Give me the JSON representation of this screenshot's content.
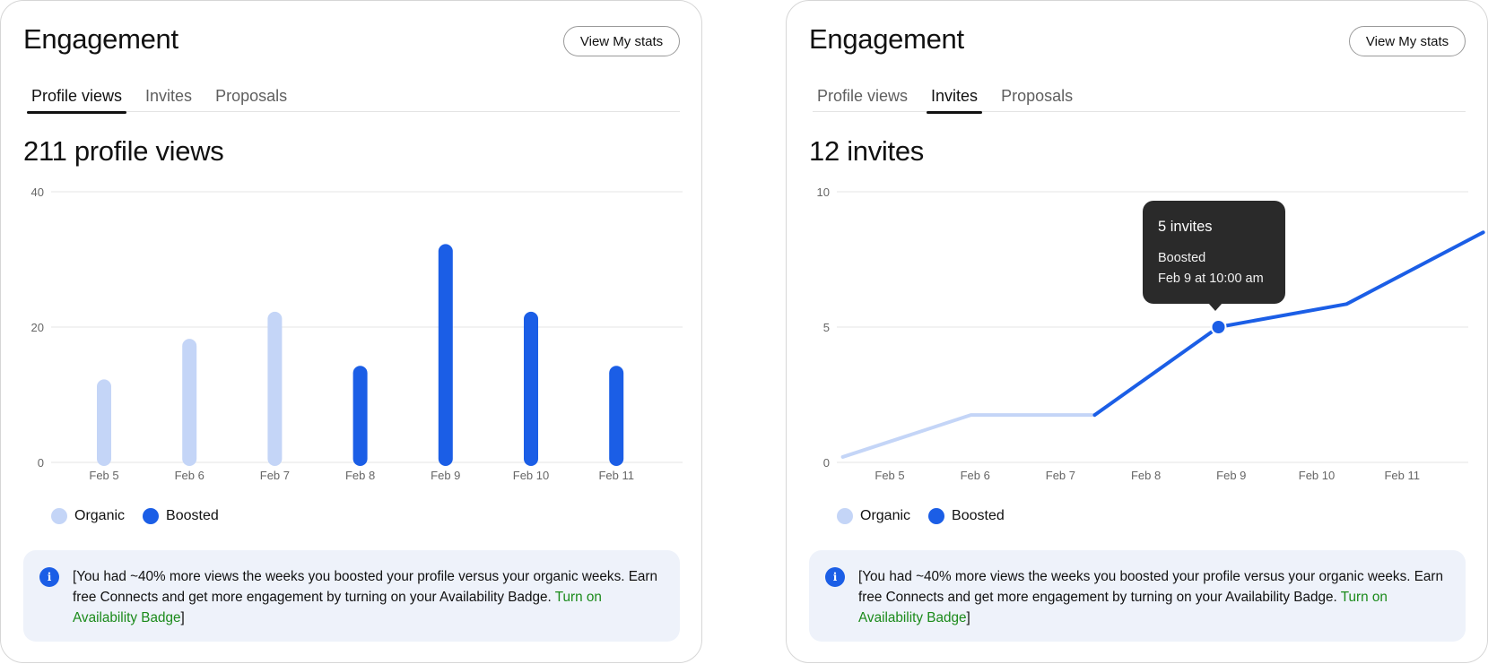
{
  "colors": {
    "organic": "#c4d5f7",
    "boosted": "#1b5ee6",
    "grid": "#e6e6e6",
    "axis_text": "#666666",
    "link": "#1a8a1a"
  },
  "cards": [
    {
      "title": "Engagement",
      "stats_button": "View My stats",
      "tabs": [
        "Profile views",
        "Invites",
        "Proposals"
      ],
      "active_tab": 0,
      "headline": "211 profile views",
      "legend": [
        "Organic",
        "Boosted"
      ],
      "info": {
        "icon": "info-icon",
        "text": "[You had ~40% more views the weeks you boosted your profile versus your organic weeks. Earn free Connects and get more engagement by turning on your Availability Badge. ",
        "link": "Turn on Availability Badge",
        "close": "]"
      }
    },
    {
      "title": "Engagement",
      "stats_button": "View My stats",
      "tabs": [
        "Profile views",
        "Invites",
        "Proposals"
      ],
      "active_tab": 1,
      "headline": "12 invites",
      "legend": [
        "Organic",
        "Boosted"
      ],
      "tooltip": {
        "title": "5 invites",
        "series": "Boosted",
        "date": "Feb 9 at 10:00 am"
      },
      "info": {
        "icon": "info-icon",
        "text": "[You had ~40% more views the weeks you boosted your profile versus your organic weeks. Earn free Connects and get more engagement by turning on your Availability Badge. ",
        "link": "Turn on Availability Badge",
        "close": "]"
      }
    }
  ],
  "chart_data": [
    {
      "type": "bar",
      "categories": [
        "Feb 5",
        "Feb 6",
        "Feb 7",
        "Feb 8",
        "Feb 9",
        "Feb 10",
        "Feb 11"
      ],
      "values": [
        12,
        18,
        22,
        14,
        32,
        22,
        14
      ],
      "kind": [
        "Organic",
        "Organic",
        "Organic",
        "Boosted",
        "Boosted",
        "Boosted",
        "Boosted"
      ],
      "yticks": [
        0,
        20,
        40
      ],
      "ylim": [
        0,
        40
      ],
      "legend": [
        "Organic",
        "Boosted"
      ],
      "legend_position": "bottom-left",
      "grid": true
    },
    {
      "type": "line",
      "categories": [
        "Feb 5",
        "Feb 6",
        "Feb 7",
        "Feb 8",
        "Feb 9",
        "Feb 10",
        "Feb 11"
      ],
      "series": [
        {
          "name": "Organic",
          "points": [
            [
              -0.55,
              0.2
            ],
            [
              0.95,
              1.75
            ],
            [
              2.4,
              1.75
            ]
          ]
        },
        {
          "name": "Boosted",
          "points": [
            [
              2.4,
              1.75
            ],
            [
              3.85,
              5.0
            ],
            [
              5.35,
              5.85
            ],
            [
              6.95,
              8.5
            ]
          ]
        }
      ],
      "highlight": {
        "series": "Boosted",
        "x": "Feb 9",
        "value": 5
      },
      "yticks": [
        0,
        5,
        10
      ],
      "ylim": [
        0,
        10
      ],
      "legend": [
        "Organic",
        "Boosted"
      ],
      "legend_position": "bottom-left",
      "grid": true
    }
  ]
}
